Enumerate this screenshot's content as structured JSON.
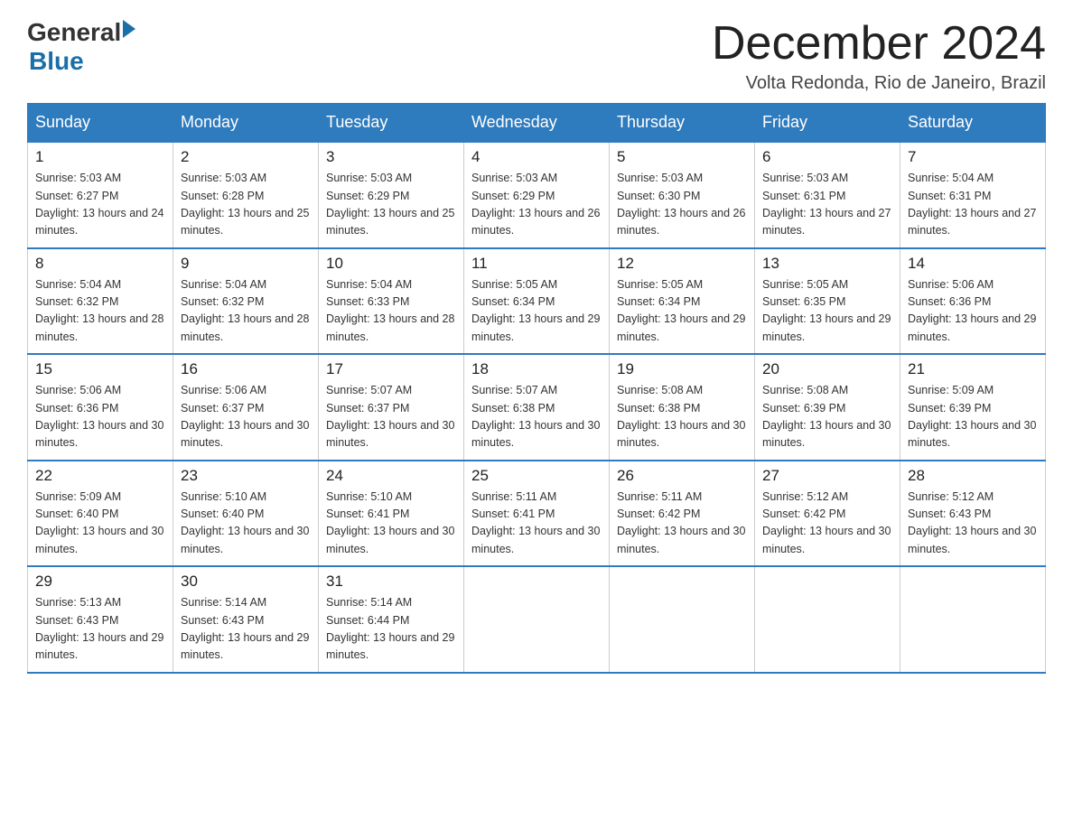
{
  "header": {
    "logo_general": "General",
    "logo_blue": "Blue",
    "title": "December 2024",
    "subtitle": "Volta Redonda, Rio de Janeiro, Brazil"
  },
  "days_of_week": [
    "Sunday",
    "Monday",
    "Tuesday",
    "Wednesday",
    "Thursday",
    "Friday",
    "Saturday"
  ],
  "weeks": [
    [
      {
        "day": "1",
        "sunrise": "Sunrise: 5:03 AM",
        "sunset": "Sunset: 6:27 PM",
        "daylight": "Daylight: 13 hours and 24 minutes."
      },
      {
        "day": "2",
        "sunrise": "Sunrise: 5:03 AM",
        "sunset": "Sunset: 6:28 PM",
        "daylight": "Daylight: 13 hours and 25 minutes."
      },
      {
        "day": "3",
        "sunrise": "Sunrise: 5:03 AM",
        "sunset": "Sunset: 6:29 PM",
        "daylight": "Daylight: 13 hours and 25 minutes."
      },
      {
        "day": "4",
        "sunrise": "Sunrise: 5:03 AM",
        "sunset": "Sunset: 6:29 PM",
        "daylight": "Daylight: 13 hours and 26 minutes."
      },
      {
        "day": "5",
        "sunrise": "Sunrise: 5:03 AM",
        "sunset": "Sunset: 6:30 PM",
        "daylight": "Daylight: 13 hours and 26 minutes."
      },
      {
        "day": "6",
        "sunrise": "Sunrise: 5:03 AM",
        "sunset": "Sunset: 6:31 PM",
        "daylight": "Daylight: 13 hours and 27 minutes."
      },
      {
        "day": "7",
        "sunrise": "Sunrise: 5:04 AM",
        "sunset": "Sunset: 6:31 PM",
        "daylight": "Daylight: 13 hours and 27 minutes."
      }
    ],
    [
      {
        "day": "8",
        "sunrise": "Sunrise: 5:04 AM",
        "sunset": "Sunset: 6:32 PM",
        "daylight": "Daylight: 13 hours and 28 minutes."
      },
      {
        "day": "9",
        "sunrise": "Sunrise: 5:04 AM",
        "sunset": "Sunset: 6:32 PM",
        "daylight": "Daylight: 13 hours and 28 minutes."
      },
      {
        "day": "10",
        "sunrise": "Sunrise: 5:04 AM",
        "sunset": "Sunset: 6:33 PM",
        "daylight": "Daylight: 13 hours and 28 minutes."
      },
      {
        "day": "11",
        "sunrise": "Sunrise: 5:05 AM",
        "sunset": "Sunset: 6:34 PM",
        "daylight": "Daylight: 13 hours and 29 minutes."
      },
      {
        "day": "12",
        "sunrise": "Sunrise: 5:05 AM",
        "sunset": "Sunset: 6:34 PM",
        "daylight": "Daylight: 13 hours and 29 minutes."
      },
      {
        "day": "13",
        "sunrise": "Sunrise: 5:05 AM",
        "sunset": "Sunset: 6:35 PM",
        "daylight": "Daylight: 13 hours and 29 minutes."
      },
      {
        "day": "14",
        "sunrise": "Sunrise: 5:06 AM",
        "sunset": "Sunset: 6:36 PM",
        "daylight": "Daylight: 13 hours and 29 minutes."
      }
    ],
    [
      {
        "day": "15",
        "sunrise": "Sunrise: 5:06 AM",
        "sunset": "Sunset: 6:36 PM",
        "daylight": "Daylight: 13 hours and 30 minutes."
      },
      {
        "day": "16",
        "sunrise": "Sunrise: 5:06 AM",
        "sunset": "Sunset: 6:37 PM",
        "daylight": "Daylight: 13 hours and 30 minutes."
      },
      {
        "day": "17",
        "sunrise": "Sunrise: 5:07 AM",
        "sunset": "Sunset: 6:37 PM",
        "daylight": "Daylight: 13 hours and 30 minutes."
      },
      {
        "day": "18",
        "sunrise": "Sunrise: 5:07 AM",
        "sunset": "Sunset: 6:38 PM",
        "daylight": "Daylight: 13 hours and 30 minutes."
      },
      {
        "day": "19",
        "sunrise": "Sunrise: 5:08 AM",
        "sunset": "Sunset: 6:38 PM",
        "daylight": "Daylight: 13 hours and 30 minutes."
      },
      {
        "day": "20",
        "sunrise": "Sunrise: 5:08 AM",
        "sunset": "Sunset: 6:39 PM",
        "daylight": "Daylight: 13 hours and 30 minutes."
      },
      {
        "day": "21",
        "sunrise": "Sunrise: 5:09 AM",
        "sunset": "Sunset: 6:39 PM",
        "daylight": "Daylight: 13 hours and 30 minutes."
      }
    ],
    [
      {
        "day": "22",
        "sunrise": "Sunrise: 5:09 AM",
        "sunset": "Sunset: 6:40 PM",
        "daylight": "Daylight: 13 hours and 30 minutes."
      },
      {
        "day": "23",
        "sunrise": "Sunrise: 5:10 AM",
        "sunset": "Sunset: 6:40 PM",
        "daylight": "Daylight: 13 hours and 30 minutes."
      },
      {
        "day": "24",
        "sunrise": "Sunrise: 5:10 AM",
        "sunset": "Sunset: 6:41 PM",
        "daylight": "Daylight: 13 hours and 30 minutes."
      },
      {
        "day": "25",
        "sunrise": "Sunrise: 5:11 AM",
        "sunset": "Sunset: 6:41 PM",
        "daylight": "Daylight: 13 hours and 30 minutes."
      },
      {
        "day": "26",
        "sunrise": "Sunrise: 5:11 AM",
        "sunset": "Sunset: 6:42 PM",
        "daylight": "Daylight: 13 hours and 30 minutes."
      },
      {
        "day": "27",
        "sunrise": "Sunrise: 5:12 AM",
        "sunset": "Sunset: 6:42 PM",
        "daylight": "Daylight: 13 hours and 30 minutes."
      },
      {
        "day": "28",
        "sunrise": "Sunrise: 5:12 AM",
        "sunset": "Sunset: 6:43 PM",
        "daylight": "Daylight: 13 hours and 30 minutes."
      }
    ],
    [
      {
        "day": "29",
        "sunrise": "Sunrise: 5:13 AM",
        "sunset": "Sunset: 6:43 PM",
        "daylight": "Daylight: 13 hours and 29 minutes."
      },
      {
        "day": "30",
        "sunrise": "Sunrise: 5:14 AM",
        "sunset": "Sunset: 6:43 PM",
        "daylight": "Daylight: 13 hours and 29 minutes."
      },
      {
        "day": "31",
        "sunrise": "Sunrise: 5:14 AM",
        "sunset": "Sunset: 6:44 PM",
        "daylight": "Daylight: 13 hours and 29 minutes."
      },
      null,
      null,
      null,
      null
    ]
  ]
}
